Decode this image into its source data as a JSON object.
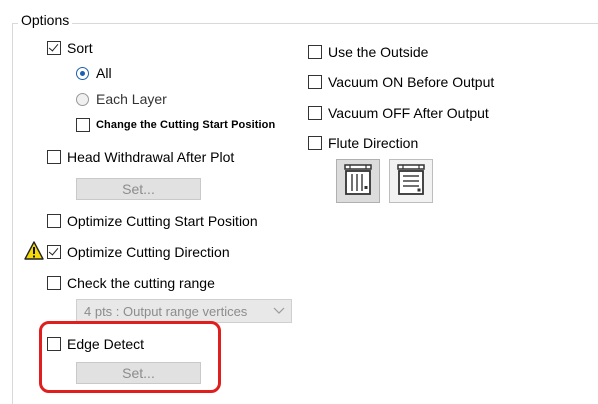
{
  "group": {
    "title": "Options"
  },
  "left": {
    "sort": {
      "label": "Sort",
      "checked": true
    },
    "all": {
      "label": "All",
      "selected": true
    },
    "each_layer": {
      "label": "Each Layer",
      "selected": false
    },
    "change_start": {
      "label": "Change the Cutting Start Position",
      "checked": false
    },
    "head_withdrawal": {
      "label": "Head Withdrawal After Plot",
      "checked": false
    },
    "head_set_button": "Set...",
    "optimize_start": {
      "label": "Optimize Cutting Start Position",
      "checked": false
    },
    "optimize_direction": {
      "label": "Optimize Cutting Direction",
      "checked": true
    },
    "check_range": {
      "label": "Check the cutting range",
      "checked": false
    },
    "range_select": {
      "value": "4 pts : Output range vertices"
    },
    "edge_detect": {
      "label": "Edge Detect",
      "checked": false
    },
    "edge_set_button": "Set..."
  },
  "right": {
    "use_outside": {
      "label": "Use the Outside",
      "checked": false
    },
    "vacuum_on": {
      "label": "Vacuum ON Before Output",
      "checked": false
    },
    "vacuum_off": {
      "label": "Vacuum OFF After Output",
      "checked": false
    },
    "flute_direction": {
      "label": "Flute Direction",
      "checked": false
    }
  },
  "colors": {
    "highlight": "#e01e1e",
    "warning": "#f5d90a",
    "radio_accent": "#1a5fb4"
  }
}
